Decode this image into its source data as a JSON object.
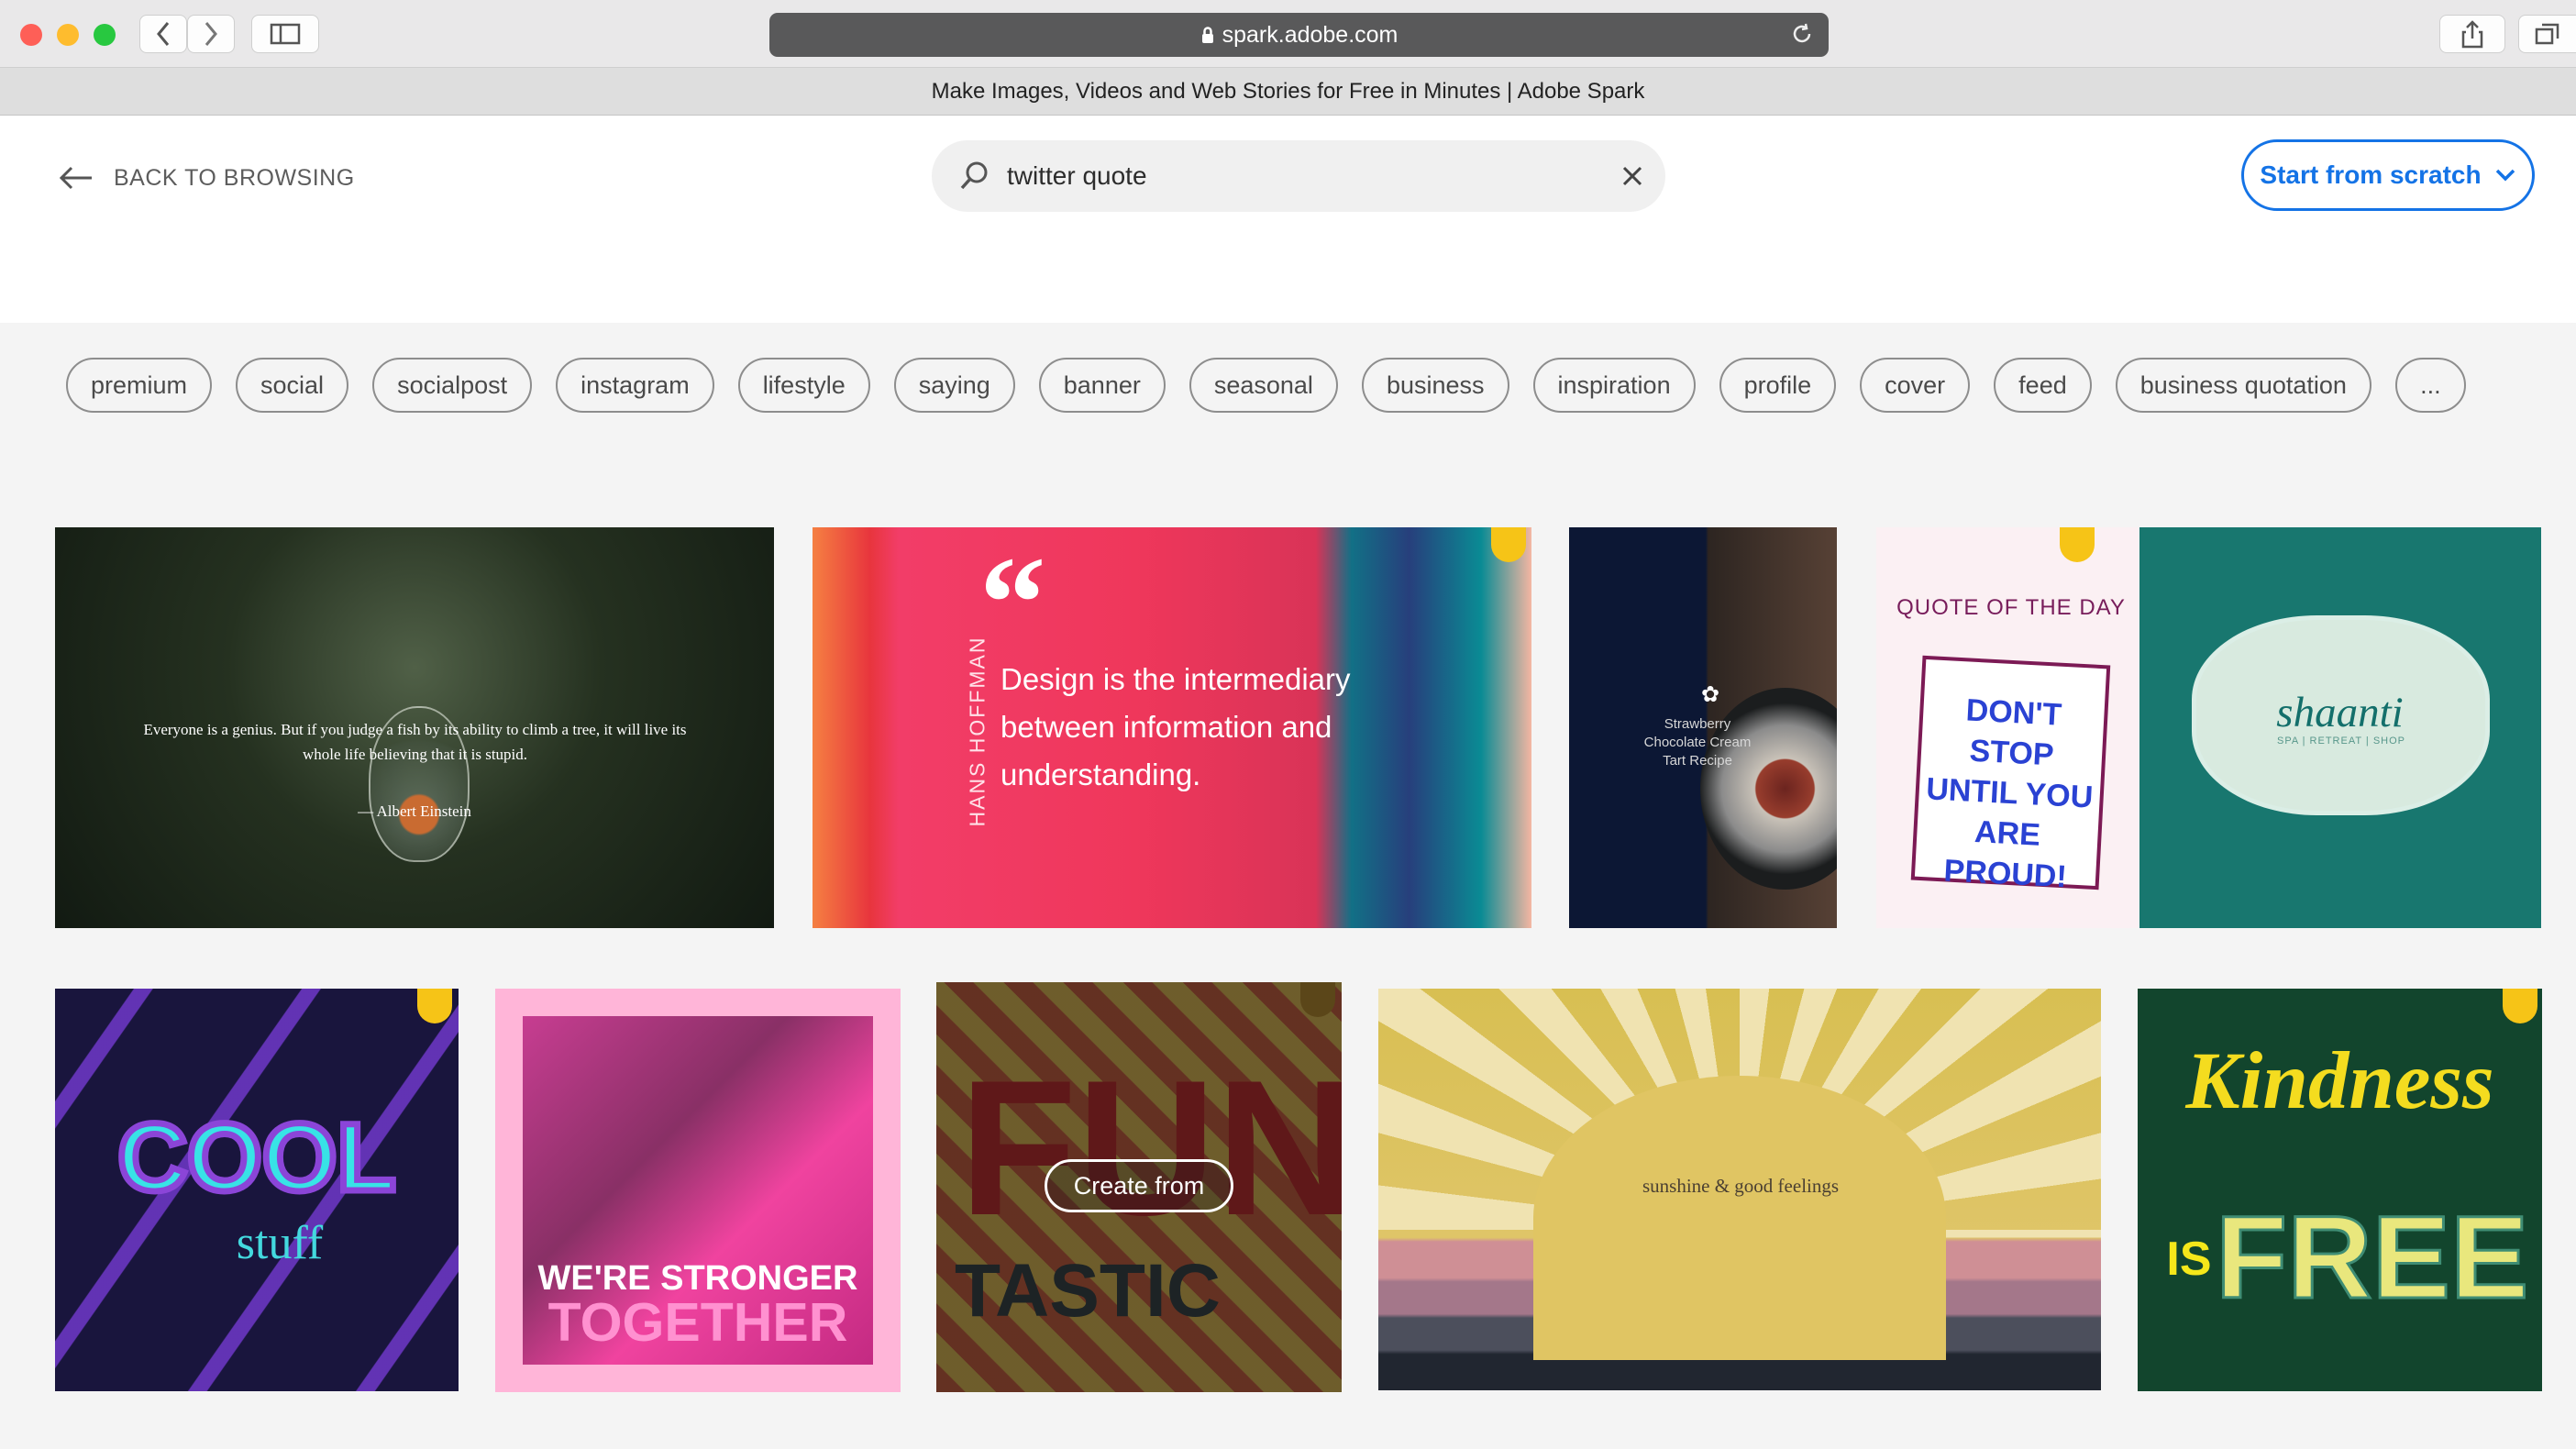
{
  "browser": {
    "address": "spark.adobe.com",
    "tab_title": "Make Images, Videos and Web Stories for Free in Minutes | Adobe Spark"
  },
  "header": {
    "back_label": "BACK TO BROWSING",
    "search_value": "twitter quote",
    "start_label": "Start from scratch"
  },
  "tags": [
    "premium",
    "social",
    "socialpost",
    "instagram",
    "lifestyle",
    "saying",
    "banner",
    "seasonal",
    "business",
    "inspiration",
    "profile",
    "cover",
    "feed",
    "business quotation",
    "..."
  ],
  "cards": {
    "einstein": {
      "quote": "Everyone is a genius. But if you judge a fish by its ability to climb a tree, it will live its whole life believing that it is stupid.",
      "author": "— Albert Einstein"
    },
    "design": {
      "mark": "“",
      "quote": "Design is the intermediary between information and understanding.",
      "author": "HANS HOFFMAN"
    },
    "recipe": {
      "title": "Strawberry Chocolate Cream Tart Recipe"
    },
    "quote_day": {
      "title": "QUOTE OF THE DAY",
      "text": "DON'T STOP UNTIL YOU ARE PROUD!"
    },
    "shaanti": {
      "logo": "shaanti",
      "subtitle": "SPA | RETREAT | SHOP"
    },
    "cool": {
      "text1": "COOL",
      "text2": "stuff"
    },
    "stronger": {
      "line1": "WE'RE STRONGER",
      "line2": "TOGETHER"
    },
    "fun": {
      "line1": "FUN",
      "line2": "TASTIC",
      "create_label": "Create from"
    },
    "sunshine": {
      "text": "sunshine & good feelings"
    },
    "kindness": {
      "line1": "Kindness",
      "line2": "IS",
      "line3": "FREE"
    }
  }
}
